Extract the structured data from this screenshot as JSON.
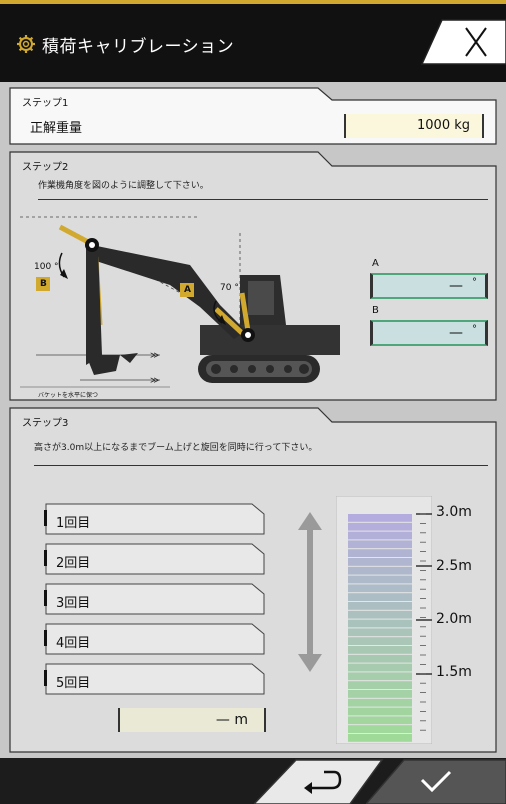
{
  "header": {
    "title": "積荷キャリブレーション",
    "gear_icon": "gear-icon",
    "close_icon": "close-icon"
  },
  "step1": {
    "label": "ステップ1",
    "weight_label": "正解重量",
    "weight_value": "1000 kg"
  },
  "step2": {
    "label": "ステップ2",
    "instruction": "作業機角度を図のように調整して下さい。",
    "angle_b_text": "100 °",
    "angle_a_text": "70 °",
    "marker_a": "A",
    "marker_b": "B",
    "bucket_note": "バケットを水平に保つ",
    "fields": [
      {
        "label": "A",
        "value": "—",
        "unit": "°"
      },
      {
        "label": "B",
        "value": "—",
        "unit": "°"
      }
    ]
  },
  "step3": {
    "label": "ステップ3",
    "instruction": "高さが3.0m以上になるまでブーム上げと旋回を同時に行って下さい。",
    "rounds": [
      "1回目",
      "2回目",
      "3回目",
      "4回目",
      "5回目"
    ],
    "height_value": "— m",
    "scale_labels": [
      "3.0m",
      "2.5m",
      "2.0m",
      "1.5m"
    ],
    "up_down_icon": "up-down-arrow-icon"
  },
  "footer": {
    "back_icon": "return-arrow-icon",
    "confirm_icon": "check-icon"
  },
  "colors": {
    "accent": "#d2a92f",
    "panel_bg": "#dcdcdc",
    "background": "#c7c7c7",
    "header_bg": "#111111",
    "field_border": "#4ea67a"
  }
}
